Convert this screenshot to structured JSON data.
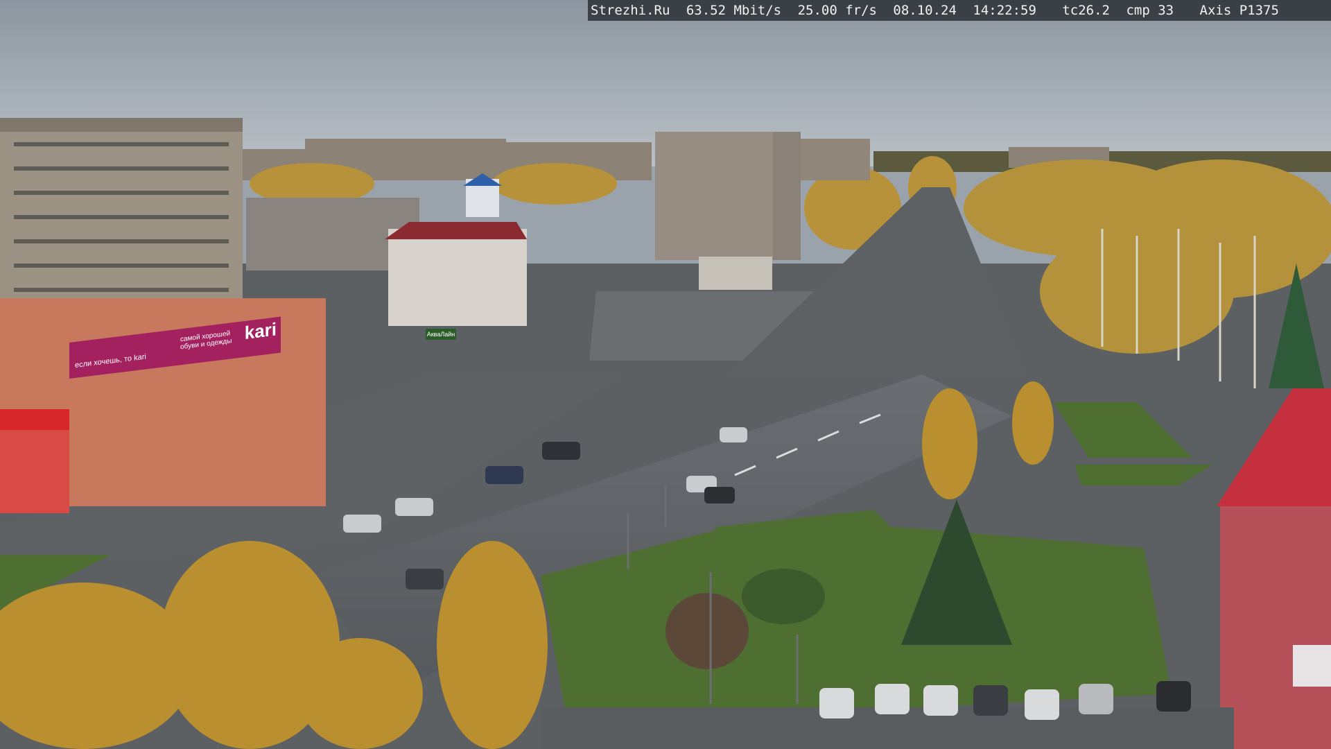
{
  "overlay": {
    "site": "Strezhi.Ru",
    "bitrate": "63.52 Mbit/s",
    "framerate": "25.00 fr/s",
    "date": "08.10.24",
    "time": "14:22:59",
    "tc": "tc26.2",
    "cmp": "cmp 33",
    "camera": "Axis P1375"
  },
  "signage": {
    "store_brand": "kari",
    "store_slogan": "если хочешь, то kari",
    "store_tagline": "самой хорошей обуви и одежды",
    "shop_name": "АкваЛайн"
  },
  "colors": {
    "sky": "#a7b0b8",
    "asphalt": "#55595d",
    "grass": "#4f6e32",
    "foliage": "#c99a2c",
    "kari_magenta": "#a4215f",
    "roof_red": "#b8283a"
  }
}
